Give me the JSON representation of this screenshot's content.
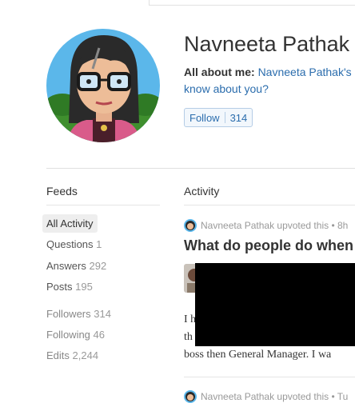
{
  "profile": {
    "name": "Navneeta Pathak",
    "about_label": "All about me:",
    "about_link": "Navneeta Pathak's",
    "about_link2": "know about you?",
    "follow_label": "Follow",
    "follow_count": "314"
  },
  "sidebar": {
    "title": "Feeds",
    "items": [
      {
        "label": "All Activity",
        "count": ""
      },
      {
        "label": "Questions",
        "count": "1"
      },
      {
        "label": "Answers",
        "count": "292"
      },
      {
        "label": "Posts",
        "count": "195"
      },
      {
        "label": "Followers",
        "count": "314"
      },
      {
        "label": "Following",
        "count": "46"
      },
      {
        "label": "Edits",
        "count": "2,244"
      }
    ]
  },
  "activity": {
    "title": "Activity",
    "story1": {
      "meta": "Navneeta Pathak upvoted this • 8h",
      "question": "What do people do when li",
      "line1": "I h",
      "line2": "th",
      "line3": "boss then General  Manager. I wa"
    },
    "story2": {
      "meta": "Navneeta Pathak upvoted this • Tu"
    }
  },
  "icons": {
    "avatar": "cartoon-woman-glasses-avatar"
  }
}
